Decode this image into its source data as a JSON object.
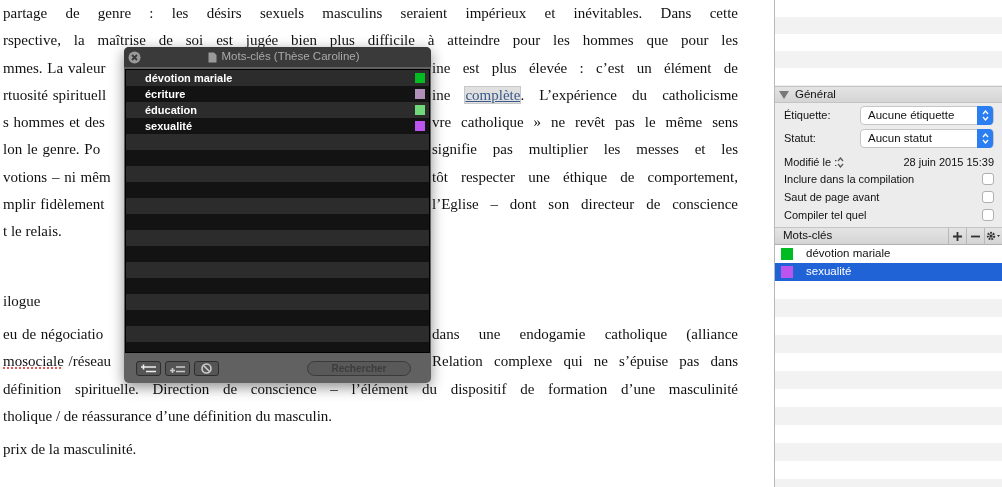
{
  "document": {
    "paragraphs": [
      {
        "kind": "body",
        "lines": [
          {
            "left": [
              {
                "text": "partage de genre : les désirs sexuels masculins seraient impérieux et inévitables. Dans cette"
              }
            ]
          },
          {
            "left": [
              {
                "text": "rspective, la maîtrise de soi est jugée bien plus difficile à atteindre pour les hommes que pour les"
              }
            ]
          },
          {
            "left": [
              {
                "text": "mmes. La valeur"
              }
            ],
            "right": [
              {
                "text": "ine est plus élevée : c’est un élément de"
              }
            ]
          },
          {
            "left": [
              {
                "text": "rtuosité spirituell"
              }
            ],
            "right": [
              {
                "text": "ine "
              },
              {
                "text": "complète",
                "kind": "link"
              },
              {
                "text": ". L’expérience du catholicisme"
              }
            ]
          },
          {
            "left": [
              {
                "text": "s hommes et des"
              }
            ],
            "right": [
              {
                "text": "vre catholique » ne revêt pas le même sens"
              }
            ]
          },
          {
            "left": [
              {
                "text": "lon le genre. Po"
              }
            ],
            "right": [
              {
                "text": "signifie pas multiplier les messes et les"
              }
            ]
          },
          {
            "left": [
              {
                "text": "votions – ni mêm"
              }
            ],
            "right": [
              {
                "text": "tôt respecter une éthique de comportement,"
              }
            ]
          },
          {
            "left": [
              {
                "text": "mplir fidèlement"
              }
            ],
            "right": [
              {
                "text": "l’Eglise – dont son directeur de conscience"
              }
            ]
          },
          {
            "left": [
              {
                "text": "t le relais."
              }
            ]
          }
        ]
      },
      {
        "kind": "heading",
        "lines": [
          {
            "left": [
              {
                "text": "ilogue"
              }
            ]
          }
        ]
      },
      {
        "kind": "body",
        "lines": [
          {
            "left": [
              {
                "text": "eu de négociatio"
              }
            ],
            "right": [
              {
                "text": "dans une endogamie catholique (alliance"
              }
            ]
          },
          {
            "left": [
              {
                "text": "mosociale",
                "kind": "misspelled"
              },
              {
                "text": " /réseau"
              }
            ],
            "right": [
              {
                "text": "Relation complexe qui ne s’épuise pas dans"
              }
            ]
          },
          {
            "left": [
              {
                "text": "définition spirituelle. Direction de conscience – l’élément du dispositif de formation d’une masculinité"
              }
            ]
          },
          {
            "left": [
              {
                "text": "tholique / de réassurance d’une définition du masculin."
              }
            ]
          }
        ]
      },
      {
        "kind": "body",
        "lines": [
          {
            "left": [
              {
                "text": "prix de la masculinité."
              }
            ]
          }
        ]
      }
    ]
  },
  "keywords_panel": {
    "title": "Mots-clés (Thèse Caroline)",
    "items": [
      {
        "label": "dévotion mariale",
        "color": "#00bb22"
      },
      {
        "label": "écriture",
        "color": "#b090b8"
      },
      {
        "label": "éducation",
        "color": "#70d878"
      },
      {
        "label": "sexualité",
        "color": "#bb55ee"
      }
    ],
    "search_button": {
      "label": "Rechercher",
      "disabled": true
    }
  },
  "inspector": {
    "general": {
      "title": "Général",
      "expanded": true,
      "label_field": {
        "label": "Étiquette:",
        "value": "Aucune étiquette"
      },
      "status_field": {
        "label": "Statut:",
        "value": "Aucun statut"
      },
      "modified": {
        "label": "Modifié le :",
        "value": "28 juin 2015 15:39"
      },
      "options": [
        {
          "label": "Inclure dans la compilation",
          "checked": false
        },
        {
          "label": "Saut de page avant",
          "checked": false
        },
        {
          "label": "Compiler tel quel",
          "checked": false
        }
      ]
    },
    "keywords": {
      "title": "Mots-clés",
      "items": [
        {
          "label": "dévotion mariale",
          "color": "#00bb22",
          "selected": false
        },
        {
          "label": "sexualité",
          "color": "#bb55ee",
          "selected": true
        }
      ]
    }
  }
}
